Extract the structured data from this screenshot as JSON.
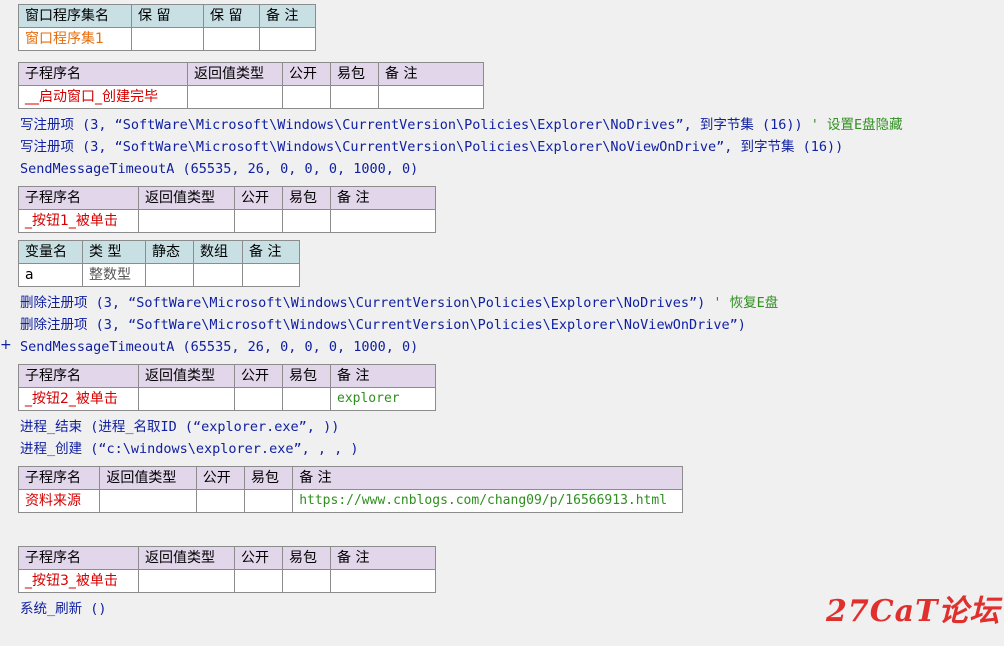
{
  "set_table": {
    "headers": [
      "窗口程序集名",
      "保 留",
      "保 留",
      "备 注"
    ],
    "row": [
      "窗口程序集1",
      "",
      "",
      ""
    ]
  },
  "sub_headers": [
    "子程序名",
    "返回值类型",
    "公开",
    "易包",
    "备 注"
  ],
  "sub1": {
    "name": "__启动窗口_创建完毕",
    "remark": ""
  },
  "code1": [
    {
      "text": "写注册项 (3, “SoftWare\\Microsoft\\Windows\\CurrentVersion\\Policies\\Explorer\\NoDrives”, 到字节集 (16)) ",
      "comment": "' 设置E盘隐藏"
    },
    {
      "text": "写注册项 (3, “SoftWare\\Microsoft\\Windows\\CurrentVersion\\Policies\\Explorer\\NoViewOnDrive”, 到字节集 (16))",
      "comment": ""
    },
    {
      "text": "SendMessageTimeoutA (65535, 26, 0, 0, 0, 1000, 0)",
      "comment": ""
    }
  ],
  "sub2": {
    "name": "_按钮1_被单击",
    "remark": ""
  },
  "var_table": {
    "headers": [
      "变量名",
      "类 型",
      "静态",
      "数组",
      "备 注"
    ],
    "row": [
      "a",
      "整数型",
      "",
      "",
      ""
    ]
  },
  "code2": [
    {
      "text": "删除注册项 (3, “SoftWare\\Microsoft\\Windows\\CurrentVersion\\Policies\\Explorer\\NoDrives”) ",
      "comment": "' 恢复E盘"
    },
    {
      "text": "删除注册项 (3, “SoftWare\\Microsoft\\Windows\\CurrentVersion\\Policies\\Explorer\\NoViewOnDrive”)",
      "comment": ""
    },
    {
      "text": "SendMessageTimeoutA (65535, 26, 0, 0, 0, 1000, 0)",
      "comment": ""
    }
  ],
  "gutter_mark": "+",
  "sub3": {
    "name": "_按钮2_被单击",
    "remark": "explorer"
  },
  "code3": [
    {
      "text": "进程_结束 (进程_名取ID (“explorer.exe”, ))",
      "comment": ""
    },
    {
      "text": "进程_创建 (“c:\\windows\\explorer.exe”, , , )",
      "comment": ""
    }
  ],
  "sub4": {
    "name": "资料来源",
    "remark": "https://www.cnblogs.com/chang09/p/16566913.html"
  },
  "sub5": {
    "name": "_按钮3_被单击",
    "remark": ""
  },
  "code5": [
    {
      "text": "系统_刷新 ()",
      "comment": ""
    }
  ],
  "watermark": "27CaT论坛",
  "colors": {
    "header_blue": "#c8e0e3",
    "header_purple": "#e2d6ea",
    "code_blue": "#1020a0",
    "name_red": "#d40000",
    "comment_green": "#2f8f1f",
    "set_orange": "#e46e0e"
  }
}
